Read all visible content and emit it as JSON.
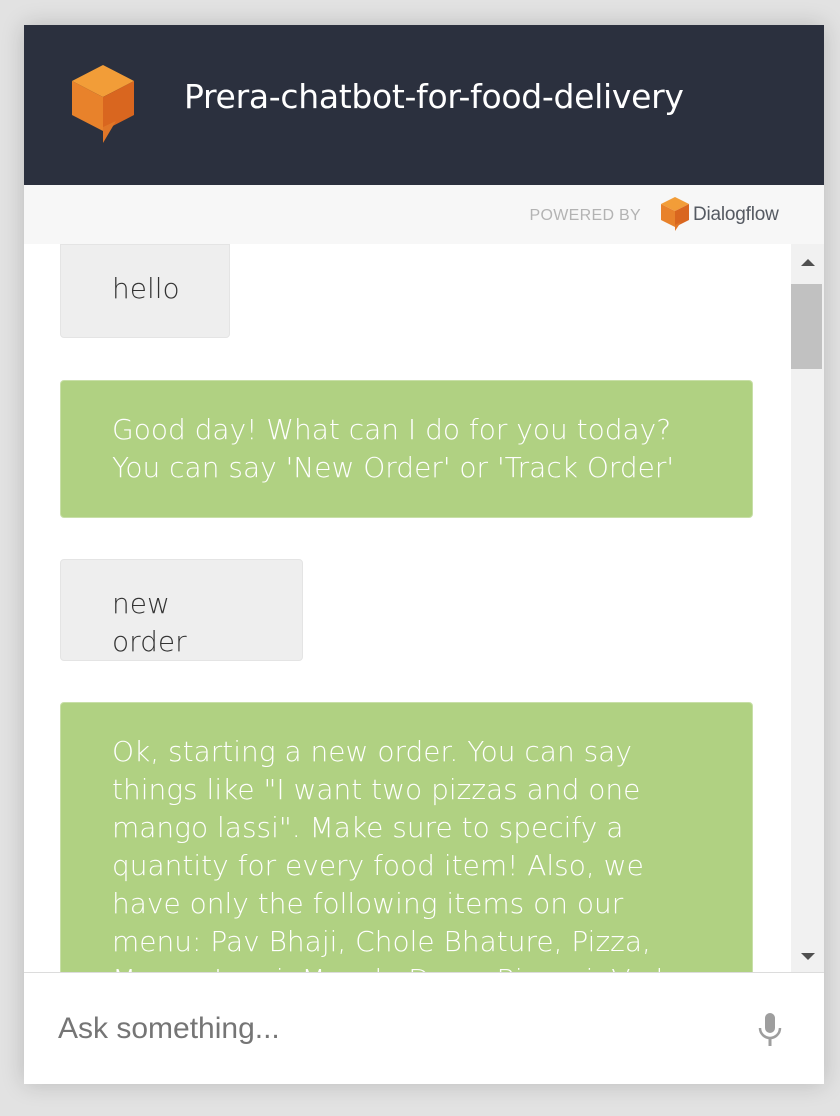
{
  "header": {
    "title": "Prera-chatbot-for-food-delivery",
    "logo_colors": {
      "top": "#f29d38",
      "left": "#e8822b",
      "right": "#d9661f"
    }
  },
  "powered_by": {
    "label": "POWERED BY",
    "brand": "Dialogflow"
  },
  "messages": [
    {
      "role": "user",
      "text": "hello"
    },
    {
      "role": "bot",
      "text": "Good day! What can I do for you today? You can say 'New Order' or 'Track Order'"
    },
    {
      "role": "user",
      "text": "new order"
    },
    {
      "role": "bot",
      "text": "Ok, starting a new order. You can say things like \"I want two pizzas and one mango lassi\". Make sure to specify a quantity for every food item! Also, we have only the following items on our menu: Pav Bhaji, Chole Bhature, Pizza, Mango Lassi, Masala Dosa, Biryani, Vada Pav, Ra"
    }
  ],
  "input": {
    "placeholder": "Ask something...",
    "value": ""
  },
  "icons": {
    "app_logo": "dialogflow-cube-icon",
    "mic": "microphone-icon",
    "scroll_up": "scroll-up-arrow-icon",
    "scroll_down": "scroll-down-arrow-icon"
  },
  "colors": {
    "header_bg": "#2b303e",
    "bot_bubble": "#b0d182",
    "user_bubble": "#eeeeee"
  }
}
